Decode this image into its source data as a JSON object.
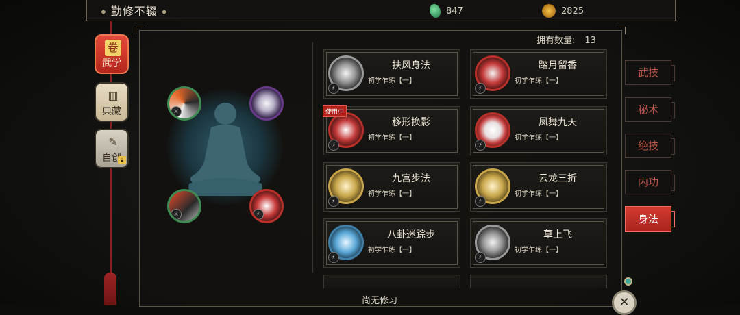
{
  "header": {
    "title": "勤修不辍",
    "jade_amount": "847",
    "coin_amount": "2825"
  },
  "sidebar": {
    "items": [
      {
        "label": "武学",
        "icon": "scroll-icon"
      },
      {
        "label": "典藏",
        "icon": "books-icon"
      },
      {
        "label": "自创",
        "icon": "quill-icon",
        "locked": true
      }
    ]
  },
  "panel": {
    "count_label": "拥有数量:",
    "count_value": "13",
    "footer_status": "尚无修习"
  },
  "skills": [
    {
      "name": "扶风身法",
      "level": "初学乍练【一】",
      "ring": "#9a9a9a",
      "in_use": false
    },
    {
      "name": "踏月留香",
      "level": "初学乍练【一】",
      "ring": "#b8302a",
      "in_use": false
    },
    {
      "name": "移形换影",
      "level": "初学乍练【一】",
      "ring": "#b8302a",
      "in_use": true,
      "badge": "使用中"
    },
    {
      "name": "凤舞九天",
      "level": "初学乍练【一】",
      "ring": "#b8302a",
      "in_use": false
    },
    {
      "name": "九宫步法",
      "level": "初学乍练【一】",
      "ring": "#c9a64a",
      "in_use": false
    },
    {
      "name": "云龙三折",
      "level": "初学乍练【一】",
      "ring": "#c9a64a",
      "in_use": false
    },
    {
      "name": "八卦迷踪步",
      "level": "初学乍练【一】",
      "ring": "#3f7fa8",
      "in_use": false
    },
    {
      "name": "草上飞",
      "level": "初学乍练【一】",
      "ring": "#9a9a9a",
      "in_use": false
    }
  ],
  "tabs": [
    "武技",
    "秘术",
    "绝技",
    "内功",
    "身法"
  ],
  "active_tab": "身法",
  "colors": {
    "accent_red": "#d23a30",
    "ring_green": "#3e8a52",
    "ring_purple": "#6a3a8a"
  }
}
